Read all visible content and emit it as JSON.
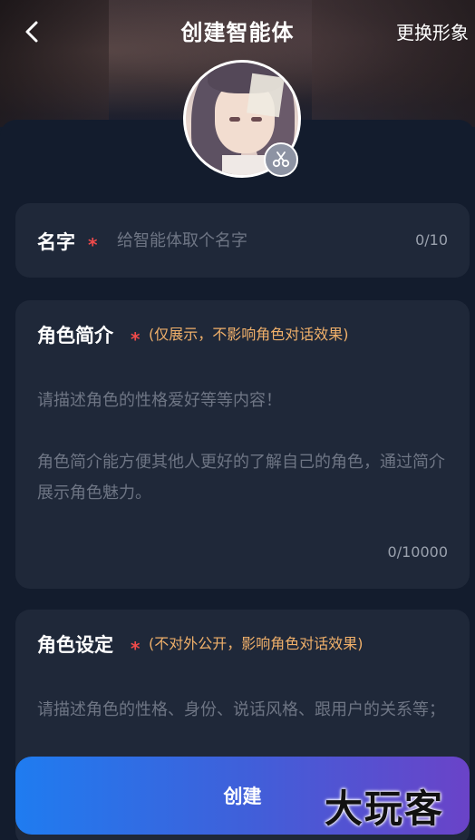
{
  "header": {
    "title": "创建智能体",
    "change_look_label": "更换形象",
    "back_icon": "chevron-left-icon"
  },
  "avatar": {
    "edit_icon": "scissors-icon"
  },
  "name_field": {
    "label": "名字",
    "required_mark": "*",
    "placeholder": "给智能体取个名字",
    "value": "",
    "counter": "0/10"
  },
  "intro_field": {
    "label": "角色简介",
    "required_mark": "*",
    "note": "(仅展示，不影响角色对话效果)",
    "placeholder": "请描述角色的性格爱好等等内容！\n\n角色简介能方便其他人更好的了解自己的角色，通过简介展示角色魅力。",
    "counter": "0/10000"
  },
  "settings_field": {
    "label": "角色设定",
    "required_mark": "*",
    "note": "(不对外公开，影响角色对话效果)",
    "placeholder": "请描述角色的性格、身份、说话风格、跟用户的关系等；"
  },
  "footer": {
    "create_label": "创建",
    "watermark": "大玩客"
  },
  "colors": {
    "background": "#131c2d",
    "card": "#1f2839",
    "required": "#ef4a4a",
    "note": "#f0b06a",
    "button_start": "#1f7cf0",
    "button_end": "#6a43c8"
  }
}
